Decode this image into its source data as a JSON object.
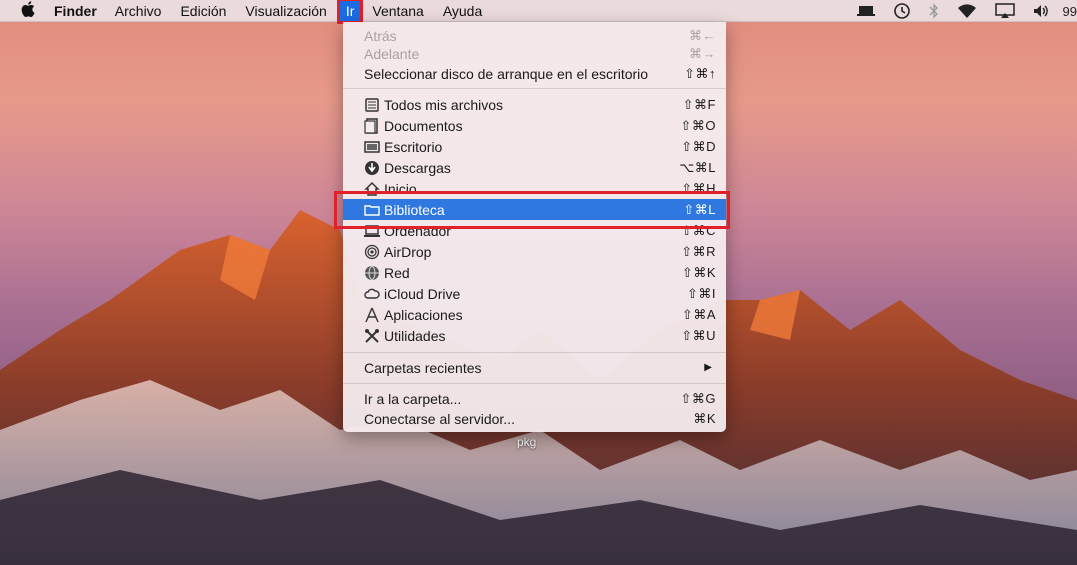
{
  "menubar": {
    "apple_icon": "apple-logo-icon",
    "app_name": "Finder",
    "menus": [
      "Archivo",
      "Edición",
      "Visualización",
      "Ir",
      "Ventana",
      "Ayuda"
    ],
    "active_menu": "Ir",
    "status": {
      "icons": [
        "display-icon",
        "time-machine-icon",
        "bluetooth-icon",
        "wifi-icon",
        "airplay-icon",
        "volume-icon"
      ],
      "battery_text": "99"
    }
  },
  "go_menu": {
    "items": [
      {
        "label": "Atrás",
        "shortcut": "⌘←",
        "disabled": true
      },
      {
        "label": "Adelante",
        "shortcut": "⌘→",
        "disabled": true
      },
      {
        "label": "Seleccionar disco de arranque en el escritorio",
        "shortcut": "⇧⌘↑"
      },
      {
        "label": "Todos mis archivos",
        "shortcut": "⇧⌘F",
        "icon": "all-files-icon"
      },
      {
        "label": "Documentos",
        "shortcut": "⇧⌘O",
        "icon": "documents-icon"
      },
      {
        "label": "Escritorio",
        "shortcut": "⇧⌘D",
        "icon": "desktop-icon"
      },
      {
        "label": "Descargas",
        "shortcut": "⌥⌘L",
        "icon": "downloads-icon"
      },
      {
        "label": "Inicio",
        "shortcut": "⇧⌘H",
        "icon": "home-icon"
      },
      {
        "label": "Biblioteca",
        "shortcut": "⇧⌘L",
        "icon": "folder-icon",
        "highlighted": true
      },
      {
        "label": "Ordenador",
        "shortcut": "⇧⌘C",
        "icon": "computer-icon"
      },
      {
        "label": "AirDrop",
        "shortcut": "⇧⌘R",
        "icon": "airdrop-icon"
      },
      {
        "label": "Red",
        "shortcut": "⇧⌘K",
        "icon": "network-icon"
      },
      {
        "label": "iCloud Drive",
        "shortcut": "⇧⌘I",
        "icon": "icloud-icon"
      },
      {
        "label": "Aplicaciones",
        "shortcut": "⇧⌘A",
        "icon": "applications-icon"
      },
      {
        "label": "Utilidades",
        "shortcut": "⇧⌘U",
        "icon": "utilities-icon"
      },
      {
        "label": "Carpetas recientes",
        "shortcut": "",
        "submenu": true
      },
      {
        "label": "Ir a la carpeta...",
        "shortcut": "⇧⌘G"
      },
      {
        "label": "Conectarse al servidor...",
        "shortcut": "⌘K"
      }
    ]
  },
  "desktop": {
    "file_label": "pkg"
  },
  "colors": {
    "highlight": "#2f78e0",
    "annotation_red": "#e0212a"
  }
}
